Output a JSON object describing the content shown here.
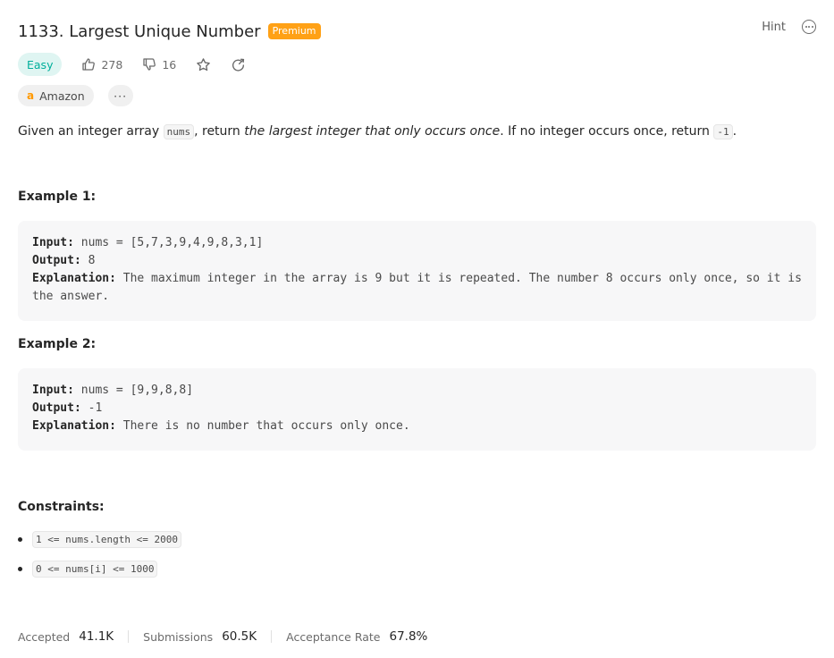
{
  "problem": {
    "title": "1133. Largest Unique Number",
    "premium_badge": "Premium",
    "hint_label": "Hint",
    "difficulty": "Easy",
    "likes": "278",
    "dislikes": "16",
    "company_tag": "Amazon",
    "more_tags_label": "···"
  },
  "description": {
    "p1": "Given an integer array ",
    "code_nums": "nums",
    "p2": ", return ",
    "emph": "the largest integer that only occurs once",
    "p3": ". If no integer occurs once, return ",
    "code_neg": "-1",
    "p4": "."
  },
  "examples": [
    {
      "heading": "Example 1:",
      "input_label": "Input:",
      "input_value": " nums = [5,7,3,9,4,9,8,3,1]",
      "output_label": "Output:",
      "output_value": " 8",
      "explanation_label": "Explanation:",
      "explanation_value": " The maximum integer in the array is 9 but it is repeated. The number 8 occurs only once, so it is the answer."
    },
    {
      "heading": "Example 2:",
      "input_label": "Input:",
      "input_value": " nums = [9,9,8,8]",
      "output_label": "Output:",
      "output_value": " -1",
      "explanation_label": "Explanation:",
      "explanation_value": " There is no number that occurs only once."
    }
  ],
  "constraints": {
    "heading": "Constraints:",
    "items": [
      "1 <= nums.length <= 2000",
      "0 <= nums[i] <= 1000"
    ]
  },
  "stats": {
    "accepted_label": "Accepted",
    "accepted_value": "41.1K",
    "submissions_label": "Submissions",
    "submissions_value": "60.5K",
    "rate_label": "Acceptance Rate",
    "rate_value": "67.8%"
  },
  "icons": {
    "like": "thumbs-up-icon",
    "dislike": "thumbs-down-icon",
    "favorite": "star-icon",
    "share": "share-icon",
    "more": "more-options-icon",
    "company": "amazon-logo-icon"
  },
  "colors": {
    "premium": "#ffa116",
    "easy_text": "#00af9b",
    "easy_bg": "#dff5f2"
  }
}
